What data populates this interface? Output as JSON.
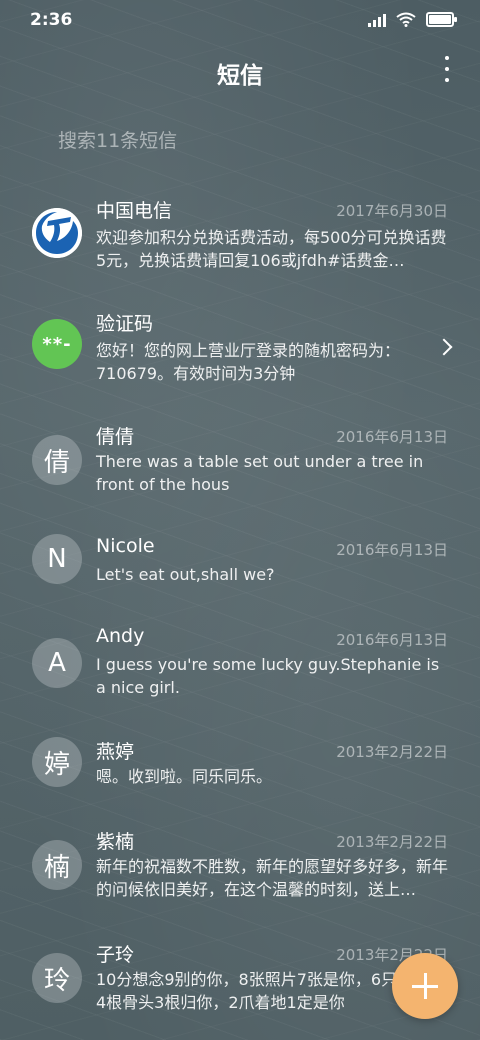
{
  "status_bar": {
    "time": "2:36"
  },
  "header": {
    "title": "短信"
  },
  "search": {
    "placeholder": "搜索11条短信"
  },
  "conversations": [
    {
      "sender": "中国电信",
      "date": "2017年6月30日",
      "preview": "欢迎参加积分兑换话费活动，每500分可兑换话费5元，兑换话费请回复106或jfdh#话费金…",
      "avatar": "telecom-logo-icon"
    },
    {
      "sender": "验证码",
      "date": "",
      "preview": "您好！您的网上营业厅登录的随机密码为：710679。有效时间为3分钟",
      "avatar_text": "**-"
    },
    {
      "sender": "倩倩",
      "date": "2016年6月13日",
      "preview": "There was a table set out under a tree in front of the hous",
      "avatar_text": "倩"
    },
    {
      "sender": "Nicole",
      "date": "2016年6月13日",
      "preview": "Let's eat out,shall we?",
      "avatar_text": "N"
    },
    {
      "sender": "Andy",
      "date": "2016年6月13日",
      "preview": "I guess you're some lucky guy.Stephanie is a nice girl.",
      "avatar_text": "A"
    },
    {
      "sender": "燕婷",
      "date": "2013年2月22日",
      "preview": "嗯。收到啦。同乐同乐。",
      "avatar_text": "婷"
    },
    {
      "sender": "紫楠",
      "date": "2013年2月22日",
      "preview": "新年的祝福数不胜数，新年的愿望好多好多，新年的问候依旧美好，在这个温馨的时刻，送上…",
      "avatar_text": "楠"
    },
    {
      "sender": "子玲",
      "date": "2013年2月22日",
      "preview": "10分想念9别的你，8张照片7张是你，6只像你，4根骨头3根归你，2爪着地1定是你",
      "avatar_text": "玲"
    }
  ],
  "colors": {
    "fab": "#f4b46f",
    "code_avatar": "#62c554",
    "telecom_blue": "#1b63b3"
  }
}
